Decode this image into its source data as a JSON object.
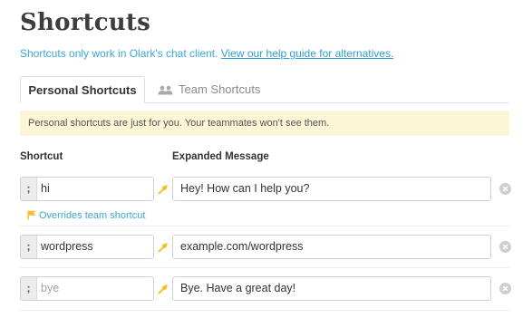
{
  "page": {
    "title": "Shortcuts",
    "subtitle_text": "Shortcuts only work in Olark's chat client.",
    "subtitle_link": "View our help guide for alternatives."
  },
  "tabs": [
    {
      "label": "Personal Shortcuts",
      "active": true
    },
    {
      "label": "Team Shortcuts",
      "active": false,
      "icon": "team-icon"
    }
  ],
  "notice": "Personal shortcuts are just for you. Your teammates won't see them.",
  "columns": {
    "shortcut": "Shortcut",
    "expanded": "Expanded Message"
  },
  "rows": [
    {
      "prefix": ";",
      "shortcut": "hi",
      "message": "Hey! How can I help you?",
      "note": "Overrides team shortcut"
    },
    {
      "prefix": ";",
      "shortcut": "wordpress",
      "message": "example.com/wordpress"
    },
    {
      "prefix": ";",
      "shortcut_placeholder": "bye",
      "message_placeholder": "Bye. Have a great day!"
    }
  ],
  "colors": {
    "link": "#3aa6d6",
    "arrow": "#f2c12e",
    "notice_bg": "#fdf6d6"
  }
}
